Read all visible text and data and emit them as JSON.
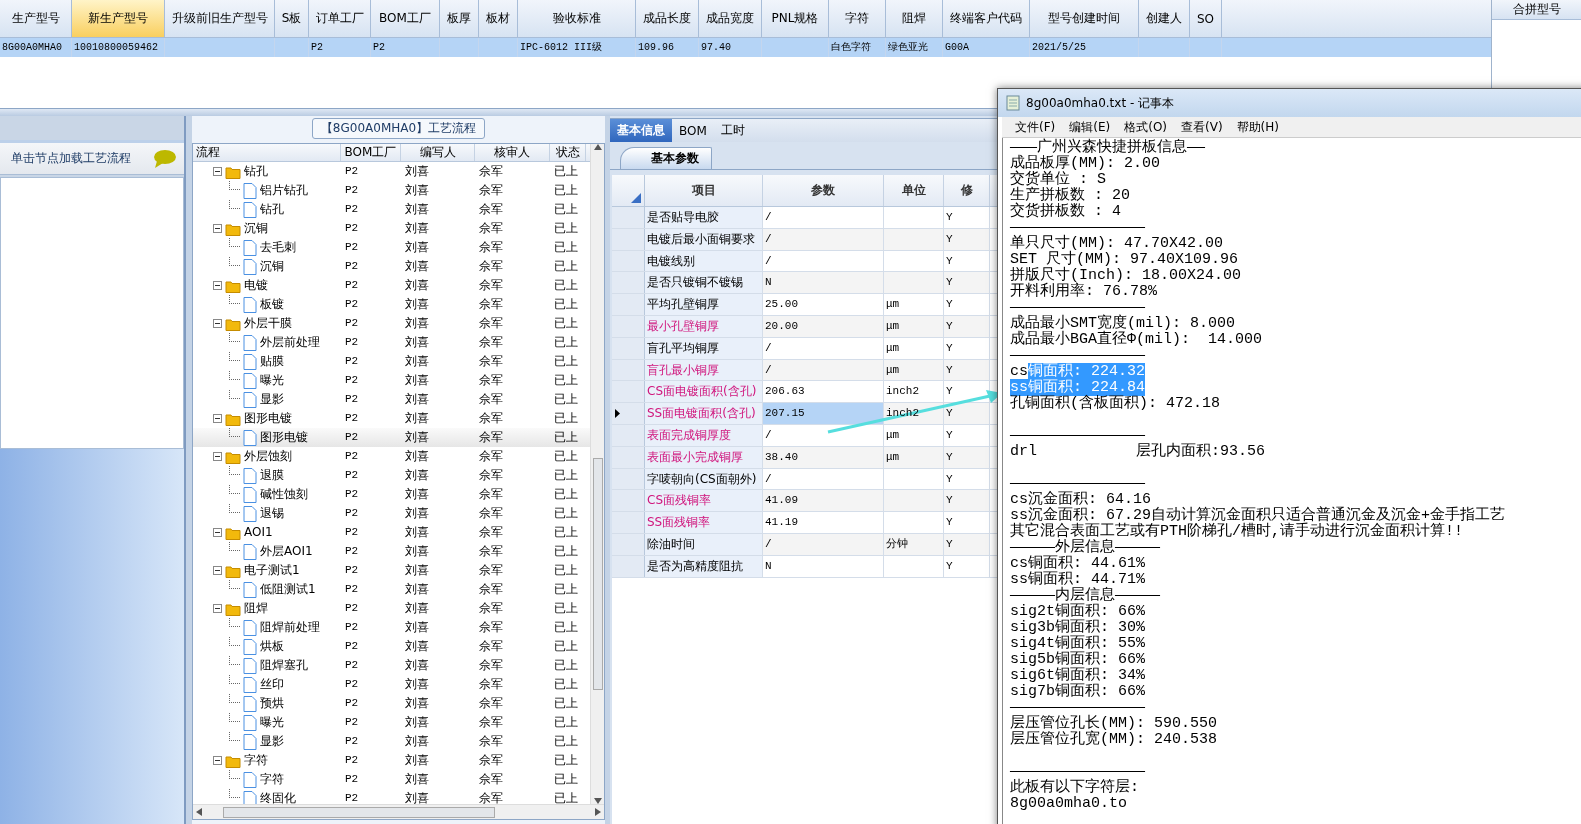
{
  "main_grid": {
    "columns": [
      {
        "label": "生产型号",
        "selected": false
      },
      {
        "label": "新生产型号",
        "selected": true
      },
      {
        "label": "升级前旧生产型号",
        "selected": false
      },
      {
        "label": "S板",
        "selected": false
      },
      {
        "label": "订单工厂",
        "selected": false
      },
      {
        "label": "BOM工厂",
        "selected": false
      },
      {
        "label": "板厚",
        "selected": false
      },
      {
        "label": "板材",
        "selected": false
      },
      {
        "label": "验收标准",
        "selected": false
      },
      {
        "label": "成品长度",
        "selected": false
      },
      {
        "label": "成品宽度",
        "selected": false
      },
      {
        "label": "PNL规格",
        "selected": false
      },
      {
        "label": "字符",
        "selected": false
      },
      {
        "label": "阻焊",
        "selected": false
      },
      {
        "label": "终端客户代码",
        "selected": false
      },
      {
        "label": "型号创建时间",
        "selected": false
      },
      {
        "label": "创建人",
        "selected": false
      },
      {
        "label": "SO",
        "selected": false
      }
    ],
    "rows": [
      {
        "selected": true,
        "cells": [
          "8G00A0MHA0",
          "10010800059462",
          null,
          null,
          "P2",
          "P2",
          null,
          null,
          "IPC-6012 III级",
          "109.96",
          "97.40",
          null,
          "白色字符",
          "绿色亚光",
          "G00A",
          "2021/5/25",
          null,
          null
        ]
      }
    ]
  },
  "side_panel": {
    "title": "合拼型号"
  },
  "left_panel": {
    "title": "单击节点加载工艺流程"
  },
  "flow_panel": {
    "title": "【8G00A0MHA0】工艺流程",
    "columns": [
      "流程",
      "BOM工厂",
      "编写人",
      "核审人",
      "状态"
    ],
    "nodes": [
      {
        "name": "钻孔",
        "factory": "P2",
        "writer": "刘喜",
        "reviewer": "佘军",
        "status": "已上",
        "expanded": true,
        "selected": false,
        "children": [
          {
            "name": "铝片钻孔",
            "factory": "P2",
            "writer": "刘喜",
            "reviewer": "佘军",
            "status": "已上",
            "selected": false
          },
          {
            "name": "钻孔",
            "factory": "P2",
            "writer": "刘喜",
            "reviewer": "佘军",
            "status": "已上",
            "selected": false
          }
        ]
      },
      {
        "name": "沉铜",
        "factory": "P2",
        "writer": "刘喜",
        "reviewer": "佘军",
        "status": "已上",
        "expanded": true,
        "selected": false,
        "children": [
          {
            "name": "去毛刺",
            "factory": "P2",
            "writer": "刘喜",
            "reviewer": "佘军",
            "status": "已上",
            "selected": false
          },
          {
            "name": "沉铜",
            "factory": "P2",
            "writer": "刘喜",
            "reviewer": "佘军",
            "status": "已上",
            "selected": false
          }
        ]
      },
      {
        "name": "电镀",
        "factory": "P2",
        "writer": "刘喜",
        "reviewer": "佘军",
        "status": "已上",
        "expanded": true,
        "selected": false,
        "children": [
          {
            "name": "板镀",
            "factory": "P2",
            "writer": "刘喜",
            "reviewer": "佘军",
            "status": "已上",
            "selected": false
          }
        ]
      },
      {
        "name": "外层干膜",
        "factory": "P2",
        "writer": "刘喜",
        "reviewer": "佘军",
        "status": "已上",
        "expanded": true,
        "selected": false,
        "children": [
          {
            "name": "外层前处理",
            "factory": "P2",
            "writer": "刘喜",
            "reviewer": "佘军",
            "status": "已上",
            "selected": false
          },
          {
            "name": "贴膜",
            "factory": "P2",
            "writer": "刘喜",
            "reviewer": "佘军",
            "status": "已上",
            "selected": false
          },
          {
            "name": "曝光",
            "factory": "P2",
            "writer": "刘喜",
            "reviewer": "佘军",
            "status": "已上",
            "selected": false
          },
          {
            "name": "显影",
            "factory": "P2",
            "writer": "刘喜",
            "reviewer": "佘军",
            "status": "已上",
            "selected": false
          }
        ]
      },
      {
        "name": "图形电镀",
        "factory": "P2",
        "writer": "刘喜",
        "reviewer": "佘军",
        "status": "已上",
        "expanded": true,
        "selected": false,
        "children": [
          {
            "name": "图形电镀",
            "factory": "P2",
            "writer": "刘喜",
            "reviewer": "佘军",
            "status": "已上",
            "selected": true
          }
        ]
      },
      {
        "name": "外层蚀刻",
        "factory": "P2",
        "writer": "刘喜",
        "reviewer": "佘军",
        "status": "已上",
        "expanded": true,
        "selected": false,
        "children": [
          {
            "name": "退膜",
            "factory": "P2",
            "writer": "刘喜",
            "reviewer": "佘军",
            "status": "已上",
            "selected": false
          },
          {
            "name": "碱性蚀刻",
            "factory": "P2",
            "writer": "刘喜",
            "reviewer": "佘军",
            "status": "已上",
            "selected": false
          },
          {
            "name": "退锡",
            "factory": "P2",
            "writer": "刘喜",
            "reviewer": "佘军",
            "status": "已上",
            "selected": false
          }
        ]
      },
      {
        "name": "AOI1",
        "factory": "P2",
        "writer": "刘喜",
        "reviewer": "佘军",
        "status": "已上",
        "expanded": true,
        "selected": false,
        "children": [
          {
            "name": "外层AOI1",
            "factory": "P2",
            "writer": "刘喜",
            "reviewer": "佘军",
            "status": "已上",
            "selected": false
          }
        ]
      },
      {
        "name": "电子测试1",
        "factory": "P2",
        "writer": "刘喜",
        "reviewer": "佘军",
        "status": "已上",
        "expanded": true,
        "selected": false,
        "children": [
          {
            "name": "低阻测试1",
            "factory": "P2",
            "writer": "刘喜",
            "reviewer": "佘军",
            "status": "已上",
            "selected": false
          }
        ]
      },
      {
        "name": "阻焊",
        "factory": "P2",
        "writer": "刘喜",
        "reviewer": "佘军",
        "status": "已上",
        "expanded": true,
        "selected": false,
        "children": [
          {
            "name": "阻焊前处理",
            "factory": "P2",
            "writer": "刘喜",
            "reviewer": "佘军",
            "status": "已上",
            "selected": false
          },
          {
            "name": "烘板",
            "factory": "P2",
            "writer": "刘喜",
            "reviewer": "佘军",
            "status": "已上",
            "selected": false
          },
          {
            "name": "阻焊塞孔",
            "factory": "P2",
            "writer": "刘喜",
            "reviewer": "佘军",
            "status": "已上",
            "selected": false
          },
          {
            "name": "丝印",
            "factory": "P2",
            "writer": "刘喜",
            "reviewer": "佘军",
            "status": "已上",
            "selected": false
          },
          {
            "name": "预烘",
            "factory": "P2",
            "writer": "刘喜",
            "reviewer": "佘军",
            "status": "已上",
            "selected": false
          },
          {
            "name": "曝光",
            "factory": "P2",
            "writer": "刘喜",
            "reviewer": "佘军",
            "status": "已上",
            "selected": false
          },
          {
            "name": "显影",
            "factory": "P2",
            "writer": "刘喜",
            "reviewer": "佘军",
            "status": "已上",
            "selected": false
          }
        ]
      },
      {
        "name": "字符",
        "factory": "P2",
        "writer": "刘喜",
        "reviewer": "佘军",
        "status": "已上",
        "expanded": true,
        "selected": false,
        "children": [
          {
            "name": "字符",
            "factory": "P2",
            "writer": "刘喜",
            "reviewer": "佘军",
            "status": "已上",
            "selected": false
          },
          {
            "name": "终固化",
            "factory": "P2",
            "writer": "刘喜",
            "reviewer": "佘军",
            "status": "已上",
            "selected": false
          }
        ]
      }
    ]
  },
  "info_panel": {
    "tabs": [
      {
        "label": "基本信息",
        "selected": true
      },
      {
        "label": "BOM",
        "selected": false
      },
      {
        "label": "工时",
        "selected": false
      }
    ],
    "subtabs": [
      {
        "label": "基本参数",
        "selected": true
      }
    ],
    "columns": [
      "项目",
      "参数",
      "单位",
      "修"
    ],
    "rows": [
      {
        "item": "是否贴导电胶",
        "value": "/",
        "modified": "Y",
        "flagged": false,
        "selected": false
      },
      {
        "item": "电镀后最小面铜要求",
        "value": "/",
        "modified": "Y",
        "flagged": false,
        "selected": false
      },
      {
        "item": "电镀线别",
        "value": "/",
        "modified": "Y",
        "flagged": false,
        "selected": false
      },
      {
        "item": "是否只镀铜不镀锡",
        "value": "N",
        "modified": "Y",
        "flagged": false,
        "selected": false
      },
      {
        "item": "平均孔壁铜厚",
        "value": "25.00",
        "unit": "μm",
        "modified": "Y",
        "flagged": false,
        "selected": false
      },
      {
        "item": "最小孔壁铜厚",
        "value": "20.00",
        "unit": "μm",
        "modified": "Y",
        "flagged": true,
        "selected": false
      },
      {
        "item": "盲孔平均铜厚",
        "value": "/",
        "unit": "μm",
        "modified": "Y",
        "flagged": false,
        "selected": false
      },
      {
        "item": "盲孔最小铜厚",
        "value": "/",
        "unit": "μm",
        "modified": "Y",
        "flagged": true,
        "selected": false
      },
      {
        "item": "CS面电镀面积(含孔)",
        "value": "206.63",
        "unit": "inch2",
        "modified": "Y",
        "flagged": true,
        "selected": false
      },
      {
        "item": "SS面电镀面积(含孔)",
        "value": "207.15",
        "unit": "inch2",
        "modified": "Y",
        "flagged": true,
        "selected": true
      },
      {
        "item": "表面完成铜厚度",
        "value": "/",
        "unit": "μm",
        "modified": "Y",
        "flagged": true,
        "selected": false
      },
      {
        "item": "表面最小完成铜厚",
        "value": "38.40",
        "unit": "μm",
        "modified": "Y",
        "flagged": true,
        "selected": false
      },
      {
        "item": "字唛朝向(CS面朝外)",
        "value": "/",
        "modified": "Y",
        "flagged": false,
        "selected": false
      },
      {
        "item": "CS面残铜率",
        "value": "41.09",
        "modified": "Y",
        "flagged": true,
        "selected": false
      },
      {
        "item": "SS面残铜率",
        "value": "41.19",
        "modified": "Y",
        "flagged": true,
        "selected": false
      },
      {
        "item": "除油时间",
        "value": "/",
        "unit": "分钟",
        "modified": "Y",
        "flagged": false,
        "selected": false
      },
      {
        "item": "是否为高精度阻抗",
        "value": "N",
        "modified": "Y",
        "flagged": false,
        "selected": false
      }
    ]
  },
  "notepad": {
    "title": "8g00a0mha0.txt - 记事本",
    "menu": [
      "文件(F)",
      "编辑(E)",
      "格式(O)",
      "查看(V)",
      "帮助(H)"
    ],
    "lines": [
      {
        "text": "———广州兴森快捷拼板信息——"
      },
      {
        "text": "成品板厚(MM): 2.00"
      },
      {
        "text": "交货单位 : S"
      },
      {
        "text": "生产拼板数 : 20"
      },
      {
        "text": "交货拼板数 : 4"
      },
      {
        "text": "———————————————"
      },
      {
        "text": "单只尺寸(MM): 47.70X42.00"
      },
      {
        "text": "SET 尺寸(MM): 97.40X109.96"
      },
      {
        "text": "拼版尺寸(Inch): 18.00X24.00"
      },
      {
        "text": "开料利用率: 76.78%"
      },
      {
        "text": "———————————————"
      },
      {
        "text": "成品最小SMT宽度(mil): 8.000"
      },
      {
        "text": "成品最小BGA直径Φ(mil):  14.000"
      },
      {
        "text": "———————————————"
      },
      {
        "spans": [
          {
            "text": "cs",
            "selected": false
          },
          {
            "text": "铜面积: 224.32",
            "selected": true
          }
        ]
      },
      {
        "spans": [
          {
            "text": "ss铜面积: 224.84",
            "selected": true
          }
        ]
      },
      {
        "text": "孔铜面积(含板面积): 472.18"
      },
      {
        "kind": "blank"
      },
      {
        "text": "———————————————"
      },
      {
        "text": "drl           层孔内面积:93.56"
      },
      {
        "kind": "blank"
      },
      {
        "text": "———————————————"
      },
      {
        "text": "cs沉金面积: 64.16"
      },
      {
        "text": "ss沉金面积: 67.29自动计算沉金面积只适合普通沉金及沉金+金手指工艺"
      },
      {
        "text": "其它混合表面工艺或有PTH阶梯孔/槽时,请手动进行沉金面积计算!!"
      },
      {
        "text": "—————外层信息—————"
      },
      {
        "text": "cs铜面积: 44.61%"
      },
      {
        "text": "ss铜面积: 44.71%"
      },
      {
        "text": "—————内层信息—————"
      },
      {
        "text": "sig2t铜面积: 66%"
      },
      {
        "text": "sig3b铜面积: 30%"
      },
      {
        "text": "sig4t铜面积: 55%"
      },
      {
        "text": "sig5b铜面积: 66%"
      },
      {
        "text": "sig6t铜面积: 34%"
      },
      {
        "text": "sig7b铜面积: 66%"
      },
      {
        "text": "———————————————"
      },
      {
        "text": "层压管位孔长(MM): 590.550"
      },
      {
        "text": "层压管位孔宽(MM): 240.538"
      },
      {
        "kind": "blank"
      },
      {
        "text": "———————————————"
      },
      {
        "text": "此板有以下字符层:"
      },
      {
        "text": "8g00a0mha0.to"
      }
    ]
  },
  "annotations": [
    {
      "kind": "arrow"
    }
  ]
}
